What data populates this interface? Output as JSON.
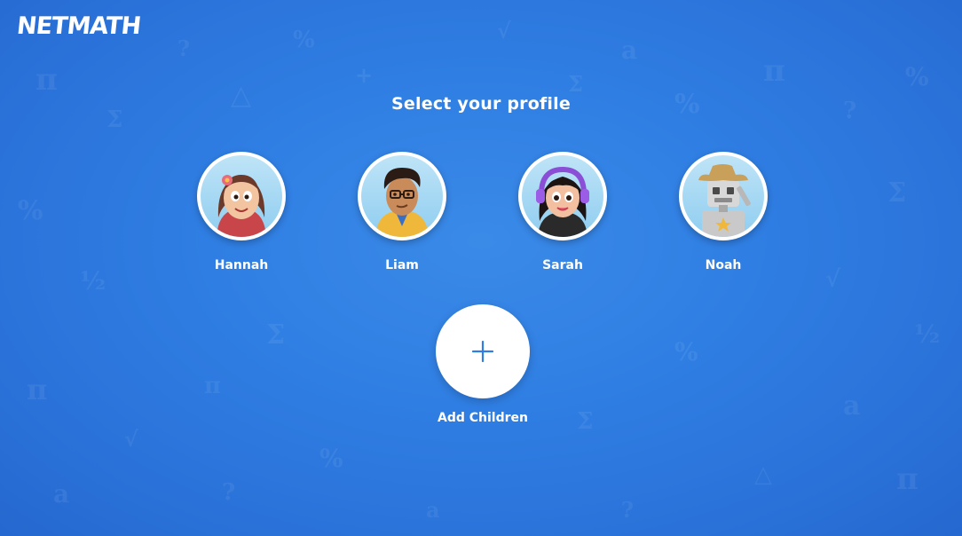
{
  "app": {
    "logo_text": "NETMATH"
  },
  "page": {
    "title": "Select your profile"
  },
  "profiles": [
    {
      "name": "Hannah",
      "avatar": "girl-with-flower-avatar"
    },
    {
      "name": "Liam",
      "avatar": "boy-with-glasses-avatar"
    },
    {
      "name": "Sarah",
      "avatar": "girl-with-headphones-avatar"
    },
    {
      "name": "Noah",
      "avatar": "robot-cowboy-avatar"
    }
  ],
  "add_children": {
    "label": "Add Children",
    "icon": "plus-icon"
  },
  "colors": {
    "background": "#2f7ee3",
    "accent": "#2f7ee3",
    "text": "#ffffff"
  }
}
